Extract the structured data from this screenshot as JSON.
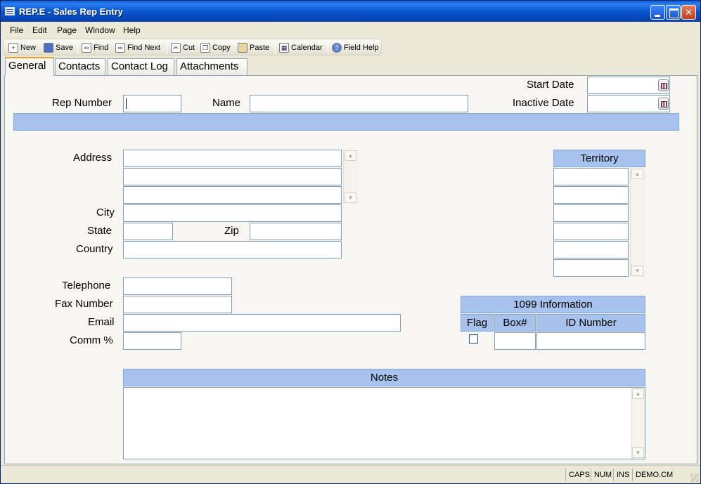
{
  "window": {
    "title": "REP.E - Sales Rep Entry"
  },
  "menu": [
    {
      "label": "File"
    },
    {
      "label": "Edit"
    },
    {
      "label": "Page"
    },
    {
      "label": "Window"
    },
    {
      "label": "Help"
    }
  ],
  "toolbar": {
    "new": "New",
    "save": "Save",
    "find": "Find",
    "find_next": "Find Next",
    "cut": "Cut",
    "copy": "Copy",
    "paste": "Paste",
    "calendar": "Calendar",
    "field_help": "Field Help"
  },
  "tabs": [
    "General",
    "Contacts",
    "Contact Log",
    "Attachments"
  ],
  "form": {
    "start_date_label": "Start Date",
    "start_date_value": "",
    "inactive_date_label": "Inactive Date",
    "inactive_date_value": "",
    "rep_number_label": "Rep Number",
    "rep_number_value": "",
    "name_label": "Name",
    "name_value": "",
    "address_label": "Address",
    "address_lines": [
      "",
      "",
      ""
    ],
    "city_label": "City",
    "city_value": "",
    "state_label": "State",
    "state_value": "",
    "zip_label": "Zip",
    "zip_value": "",
    "country_label": "Country",
    "country_value": "",
    "telephone_label": "Telephone",
    "telephone_value": "",
    "fax_label": "Fax Number",
    "fax_value": "",
    "email_label": "Email",
    "email_value": "",
    "comm_label": "Comm %",
    "comm_value": ""
  },
  "territory": {
    "header": "Territory",
    "rows": [
      "",
      "",
      "",
      "",
      "",
      ""
    ]
  },
  "info1099": {
    "header": "1099 Information",
    "flag_label": "Flag",
    "box_label": "Box#",
    "id_label": "ID Number",
    "flag_checked": false,
    "box_value": "",
    "id_value": ""
  },
  "notes": {
    "header": "Notes",
    "value": ""
  },
  "status": {
    "caps": "CAPS",
    "num": "NUM",
    "ins": "INS",
    "db": "DEMO.CM"
  }
}
